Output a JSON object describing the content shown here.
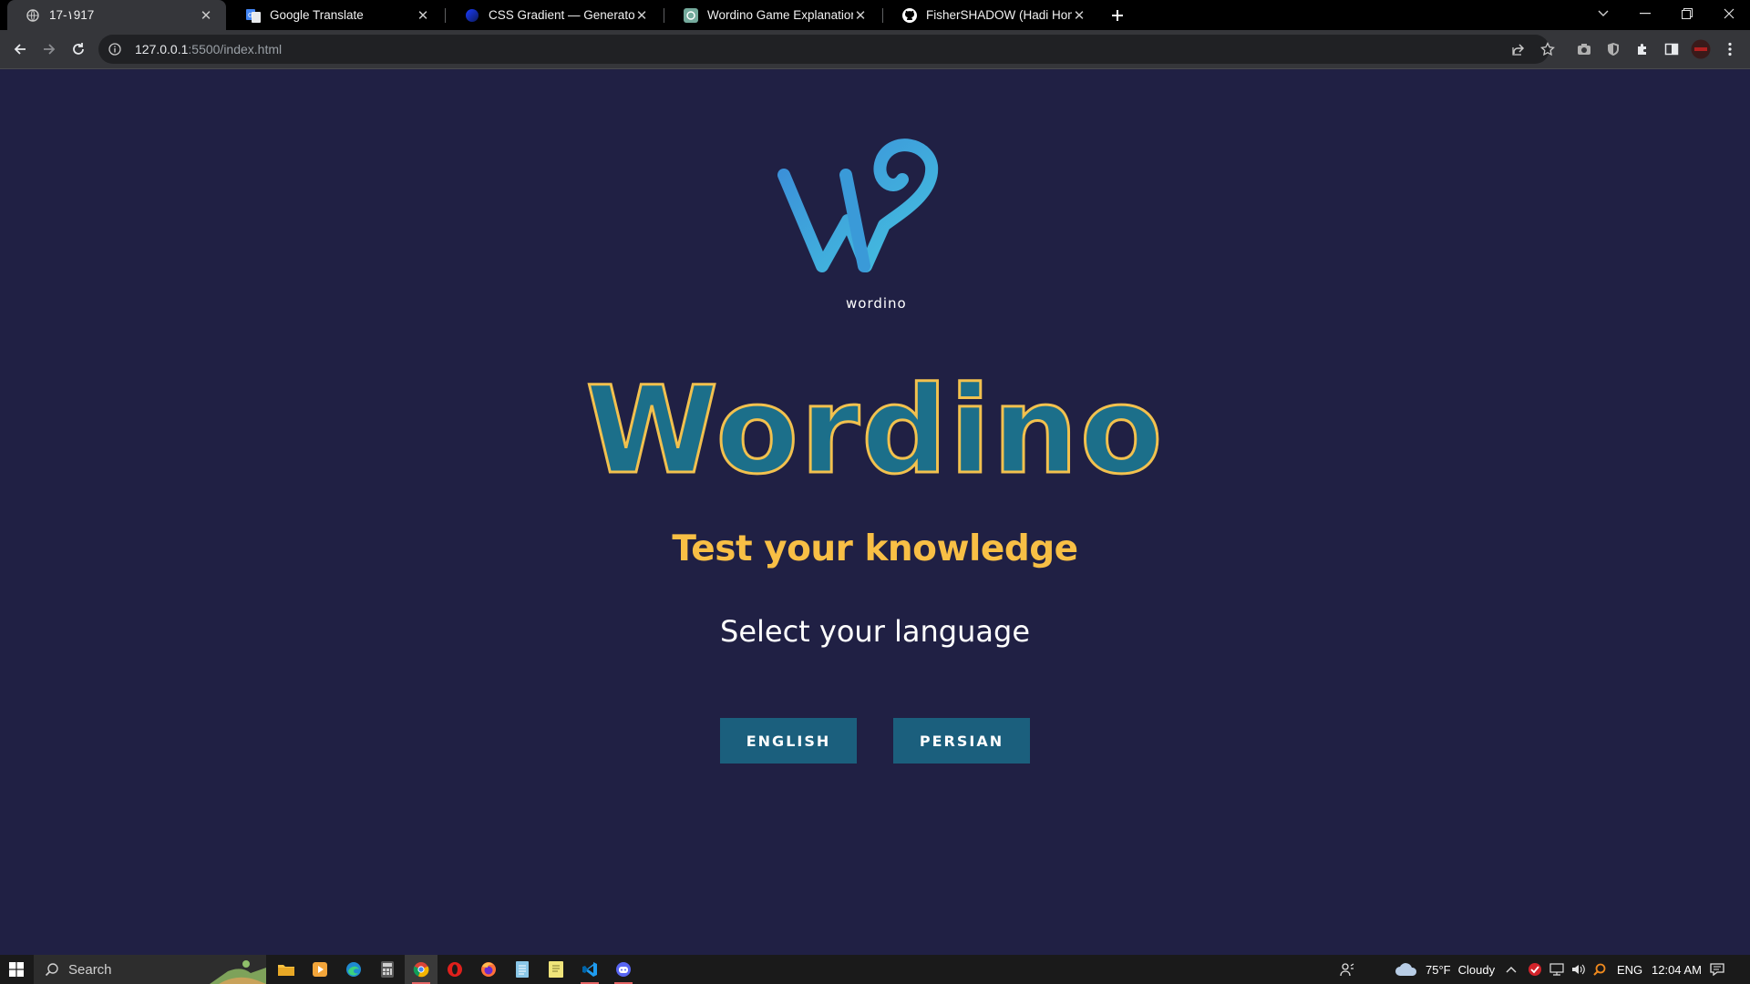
{
  "browser": {
    "tabs": [
      {
        "title": "17-۱917",
        "active": true,
        "icon": "globe-icon"
      },
      {
        "title": "Google Translate",
        "active": false,
        "icon": "google-translate-icon"
      },
      {
        "title": "CSS Gradient — Generator, Maker",
        "active": false,
        "icon": "css-gradient-icon"
      },
      {
        "title": "Wordino Game Explanation",
        "active": false,
        "icon": "chatgpt-icon"
      },
      {
        "title": "FisherSHADOW (Hadi Homaei)",
        "active": false,
        "icon": "github-icon"
      }
    ],
    "url_host": "127.0.0.1",
    "url_path": ":5500/index.html"
  },
  "page": {
    "logo_text": "wordino",
    "title": "Wordino",
    "tagline": "Test your knowledge",
    "prompt": "Select your language",
    "buttons": {
      "english": "ENGLISH",
      "persian": "PERSIAN"
    }
  },
  "taskbar": {
    "search_label": "Search",
    "weather_temp": "75°F",
    "weather_text": "Cloudy",
    "language": "ENG",
    "time": "12:04 AM"
  },
  "colors": {
    "page_bg": "#202044",
    "title_fill": "#1c6f8a",
    "title_outline": "#f2c14e",
    "tagline": "#f8bf45",
    "button_bg": "#1b5f7d"
  }
}
